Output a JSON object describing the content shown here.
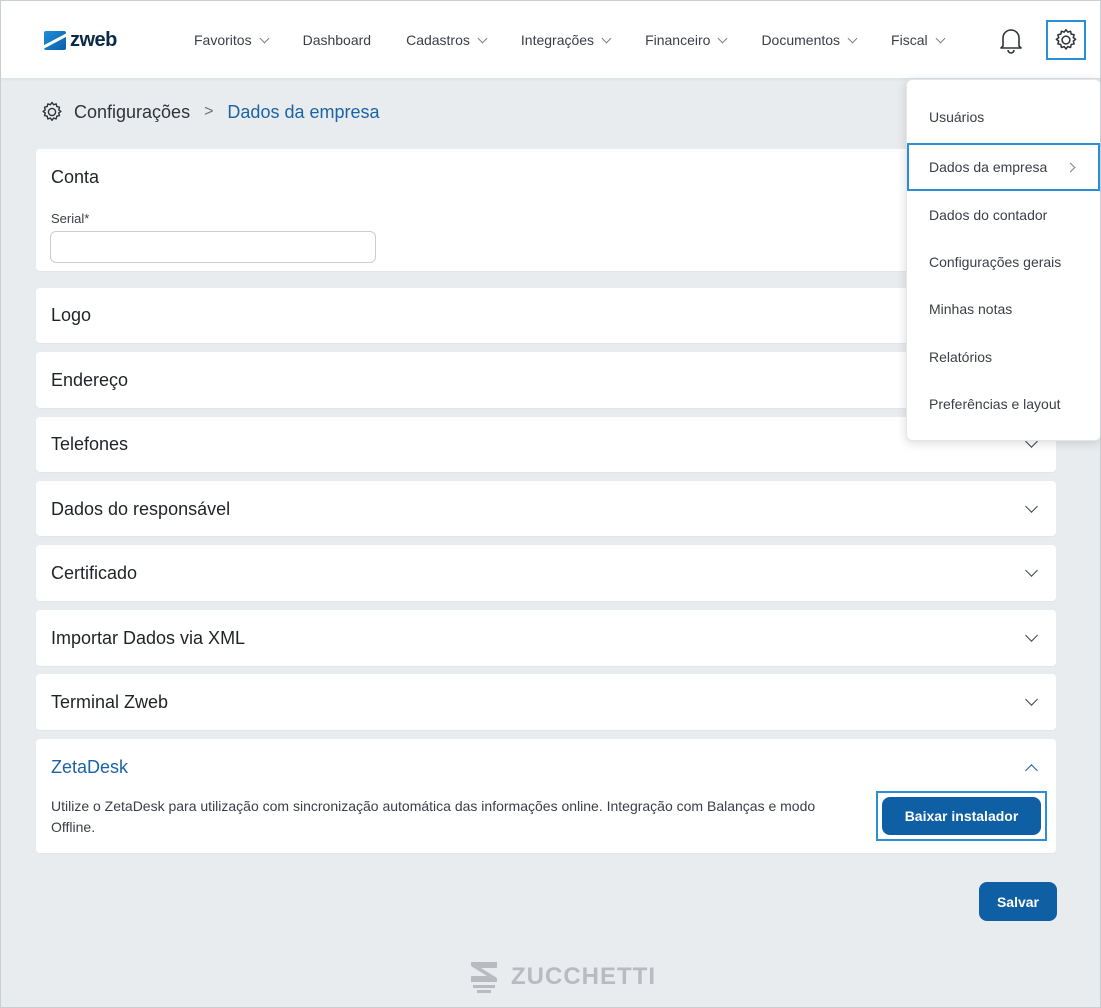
{
  "header": {
    "logo_text": "zweb",
    "nav": [
      {
        "label": "Favoritos",
        "has_menu": true
      },
      {
        "label": "Dashboard",
        "has_menu": false
      },
      {
        "label": "Cadastros",
        "has_menu": true
      },
      {
        "label": "Integrações",
        "has_menu": true
      },
      {
        "label": "Financeiro",
        "has_menu": true
      },
      {
        "label": "Documentos",
        "has_menu": true
      },
      {
        "label": "Fiscal",
        "has_menu": true
      }
    ],
    "icons": {
      "notifications": "bell-icon",
      "settings": "gear-icon"
    }
  },
  "breadcrumb": {
    "root": "Configurações",
    "separator": ">",
    "current": "Dados da empresa"
  },
  "panels": {
    "conta": {
      "title": "Conta",
      "serial_label": "Serial*",
      "serial_value": ""
    },
    "logo": {
      "title": "Logo"
    },
    "endereco": {
      "title": "Endereço"
    },
    "telefones": {
      "title": "Telefones"
    },
    "responsavel": {
      "title": "Dados do responsável"
    },
    "certificado": {
      "title": "Certificado"
    },
    "importar": {
      "title": "Importar Dados via XML"
    },
    "terminal": {
      "title": "Terminal Zweb"
    },
    "zetadesk": {
      "title": "ZetaDesk",
      "description": "Utilize o ZetaDesk para utilização com sincronização automática das informações online. Integração com Balanças e modo Offline.",
      "download_label": "Baixar instalador"
    }
  },
  "actions": {
    "save_label": "Salvar"
  },
  "settings_menu": {
    "items": [
      {
        "label": "Usuários"
      },
      {
        "label": "Dados da empresa",
        "active": true
      },
      {
        "label": "Dados do contador"
      },
      {
        "label": "Configurações gerais"
      },
      {
        "label": "Minhas notas"
      },
      {
        "label": "Relatórios"
      },
      {
        "label": "Preferências e layout"
      }
    ]
  },
  "footer": {
    "brand": "ZUCCHETTI"
  },
  "colors": {
    "accent": "#1a64a6",
    "primary_button": "#0f5fa5",
    "highlight_border": "#2c8fd6",
    "background": "#e9ecee"
  }
}
